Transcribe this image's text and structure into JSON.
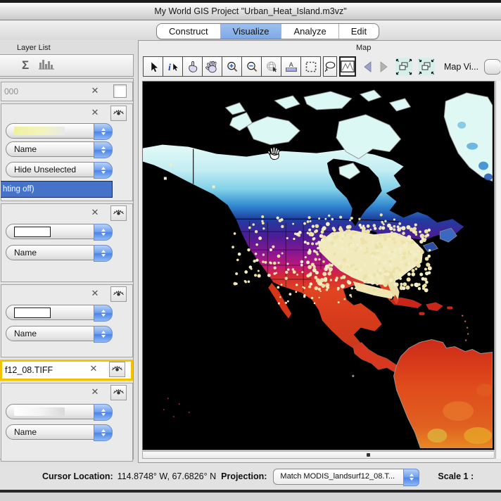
{
  "window_title": "My World GIS Project \"Urban_Heat_Island.m3vz\"",
  "tabs": [
    {
      "label": "Construct",
      "active": false
    },
    {
      "label": "Visualize",
      "active": true
    },
    {
      "label": "Analyze",
      "active": false
    },
    {
      "label": "Edit",
      "active": false
    }
  ],
  "layer_list": {
    "title": "Layer List",
    "sigma": "Σ",
    "toolbar_icons": [
      "sum-statistics-icon",
      "histogram-icon"
    ],
    "layers": [
      {
        "title": "000"
      },
      {
        "field": "Name",
        "mode": "Hide Unselected",
        "status": "hting off)",
        "swatch": "yellow-gradient"
      },
      {
        "field": "Name",
        "swatch": "rectangle-outline"
      },
      {
        "field": "Name",
        "swatch": "rectangle-outline"
      },
      {
        "title": "f12_08.TIFF",
        "highlighted": true
      },
      {
        "field": "Name",
        "swatch": "white-gradient"
      }
    ]
  },
  "map_panel": {
    "title": "Map",
    "view_button": "Map Vi...",
    "tool_icons": [
      "select-arrow",
      "info-select",
      "point-select-hand",
      "pan-hand",
      "zoom-in",
      "zoom-out",
      "globe-disabled",
      "measure-ruler",
      "marquee-select",
      "lasso-select",
      "profile-graph",
      "back",
      "forward",
      "zoom-to-extent",
      "zoom-window"
    ]
  },
  "status_bar": {
    "cursor_label": "Cursor Location:",
    "cursor_value": "114.8748° W, 67.6826° N",
    "projection_label": "Projection:",
    "projection_value": "Match MODIS_landsurf12_08.T...",
    "scale_label": "Scale 1 :"
  },
  "colors": {
    "active_tab": "#7fa9e6",
    "selection_row": "#4673c8",
    "highlight_border": "#f2c400",
    "map_cold": "#e6fbf7",
    "map_hot": "#d83c1c"
  }
}
